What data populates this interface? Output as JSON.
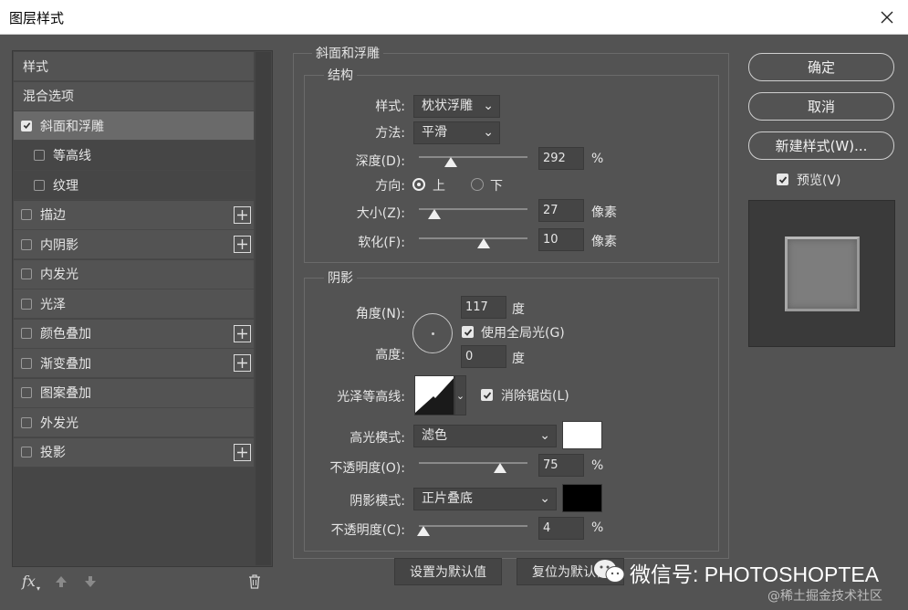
{
  "window": {
    "title": "图层样式",
    "close_icon": "close-icon"
  },
  "left": {
    "items": [
      {
        "label": "样式",
        "type": "header"
      },
      {
        "label": "混合选项",
        "type": "header"
      },
      {
        "label": "斜面和浮雕",
        "checked": true,
        "selected": true
      },
      {
        "label": "等高线",
        "checked": false,
        "sub": true
      },
      {
        "label": "纹理",
        "checked": false,
        "sub": true
      },
      {
        "label": "描边",
        "checked": false,
        "plus": true
      },
      {
        "label": "内阴影",
        "checked": false,
        "plus": true
      },
      {
        "label": "内发光",
        "checked": false
      },
      {
        "label": "光泽",
        "checked": false
      },
      {
        "label": "颜色叠加",
        "checked": false,
        "plus": true
      },
      {
        "label": "渐变叠加",
        "checked": false,
        "plus": true
      },
      {
        "label": "图案叠加",
        "checked": false
      },
      {
        "label": "外发光",
        "checked": false
      },
      {
        "label": "投影",
        "checked": false,
        "plus": true
      }
    ],
    "fx_label": "fx"
  },
  "bevel": {
    "group_title": "斜面和浮雕",
    "structure_title": "结构",
    "style_label": "样式:",
    "style_value": "枕状浮雕",
    "technique_label": "方法:",
    "technique_value": "平滑",
    "depth_label": "深度(D):",
    "depth_value": "292",
    "depth_unit": "%",
    "depth_fraction": 0.29,
    "direction_label": "方向:",
    "direction_up": "上",
    "direction_down": "下",
    "size_label": "大小(Z):",
    "size_value": "27",
    "size_unit": "像素",
    "size_fraction": 0.14,
    "soften_label": "软化(F):",
    "soften_value": "10",
    "soften_unit": "像素",
    "soften_fraction": 0.6
  },
  "shading": {
    "title": "阴影",
    "angle_label": "角度(N):",
    "angle_value": "117",
    "angle_unit": "度",
    "global_light_label": "使用全局光(G)",
    "global_light_checked": true,
    "altitude_label": "高度:",
    "altitude_value": "0",
    "altitude_unit": "度",
    "gloss_contour_label": "光泽等高线:",
    "anti_alias_label": "消除锯齿(L)",
    "anti_alias_checked": true,
    "highlight_mode_label": "高光模式:",
    "highlight_mode_value": "滤色",
    "highlight_color": "#ffffff",
    "highlight_opacity_label": "不透明度(O):",
    "highlight_opacity_value": "75",
    "highlight_opacity_unit": "%",
    "highlight_opacity_fraction": 0.75,
    "shadow_mode_label": "阴影模式:",
    "shadow_mode_value": "正片叠底",
    "shadow_color": "#000000",
    "shadow_opacity_label": "不透明度(C):",
    "shadow_opacity_value": "4",
    "shadow_opacity_unit": "%",
    "shadow_opacity_fraction": 0.04
  },
  "bottom": {
    "set_default": "设置为默认值",
    "reset_default": "复位为默认值"
  },
  "right": {
    "ok": "确定",
    "cancel": "取消",
    "new_style": "新建样式(W)...",
    "preview_label": "预览(V)",
    "preview_checked": true
  },
  "watermark": {
    "text": "微信号: PHOTOSHOPTEA",
    "credit": "@稀土掘金技术社区"
  }
}
